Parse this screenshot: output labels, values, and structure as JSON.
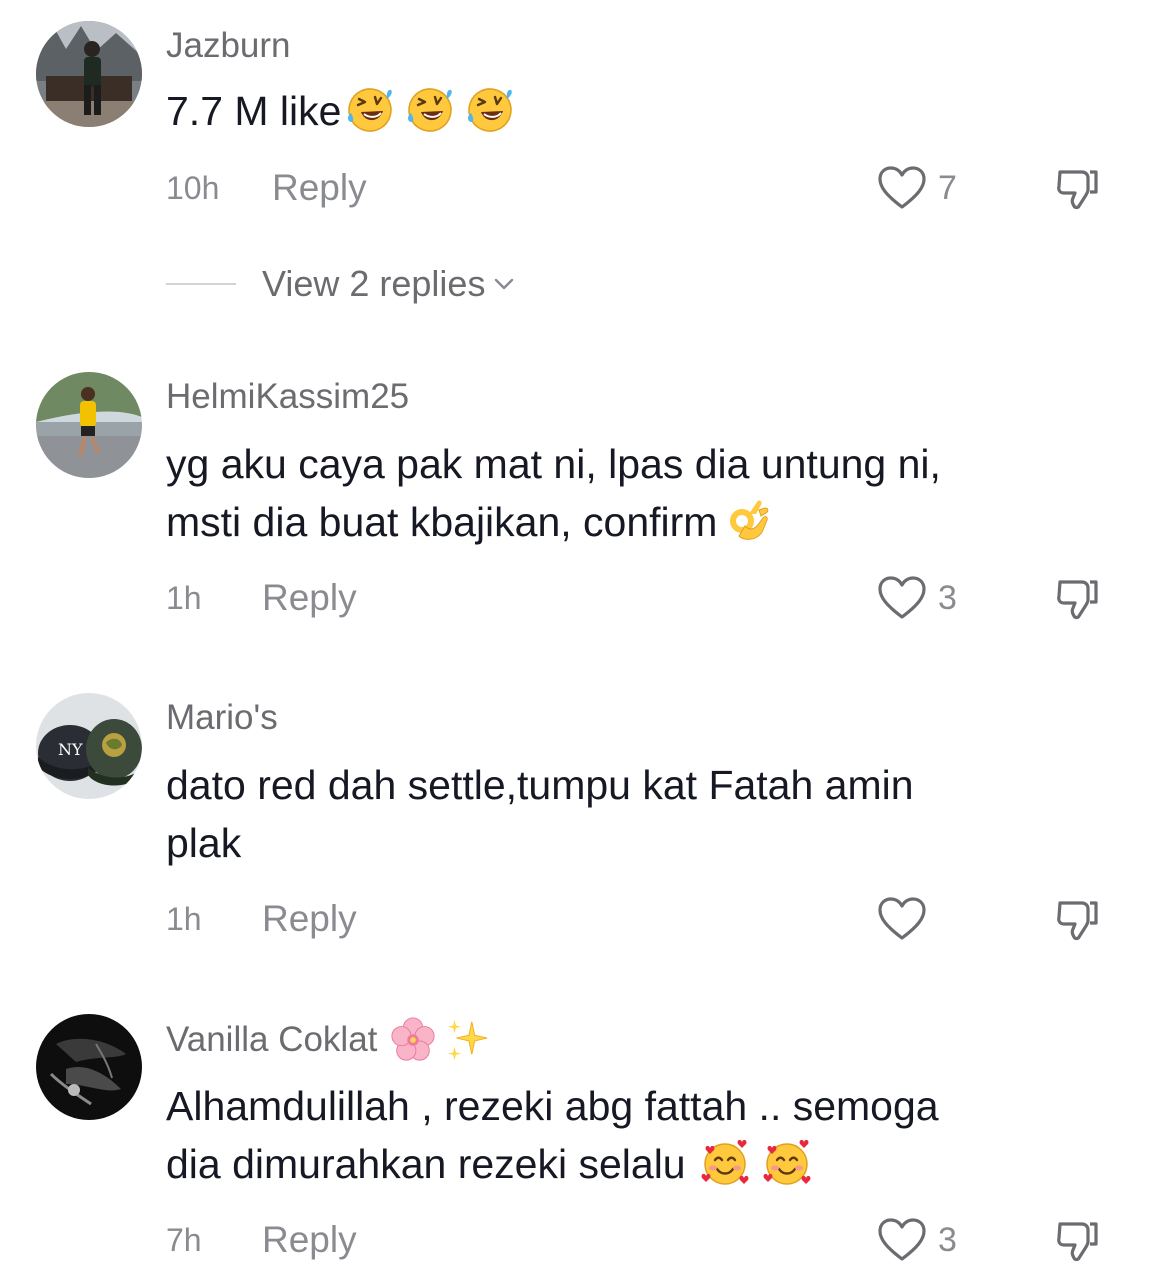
{
  "comments": [
    {
      "username": "Jazburn",
      "text": "7.7 M like",
      "text_emojis": [
        "rolling-on-floor-laughing",
        "rolling-on-floor-laughing",
        "rolling-on-floor-laughing"
      ],
      "time": "10h",
      "reply_label": "Reply",
      "likes": "7",
      "view_replies": "View 2 replies"
    },
    {
      "username": "HelmiKassim25",
      "text_line1": "yg aku caya pak mat ni, lpas dia untung ni,",
      "text_line2": "msti dia buat kbajikan, confirm",
      "text_emojis": [
        "ok-hand"
      ],
      "time": "1h",
      "reply_label": "Reply",
      "likes": "3"
    },
    {
      "username": "Mario's",
      "text_line1": "dato red dah settle,tumpu kat Fatah amin",
      "text_line2": "plak",
      "time": "1h",
      "reply_label": "Reply",
      "likes": ""
    },
    {
      "username": "Vanilla Coklat",
      "username_emojis": [
        "cherry-blossom",
        "sparkles"
      ],
      "text_line1": "Alhamdulillah , rezeki abg fattah .. semoga",
      "text_line2": "dia dimurahkan rezeki selalu",
      "text_emojis": [
        "smiling-face-with-hearts",
        "smiling-face-with-hearts"
      ],
      "time": "7h",
      "reply_label": "Reply",
      "likes": "3"
    }
  ],
  "colors": {
    "primary_text": "#161823",
    "secondary_text": "#6b6b70",
    "muted_text": "#8a8b91",
    "emoji_yellow": "#ffc83d"
  }
}
